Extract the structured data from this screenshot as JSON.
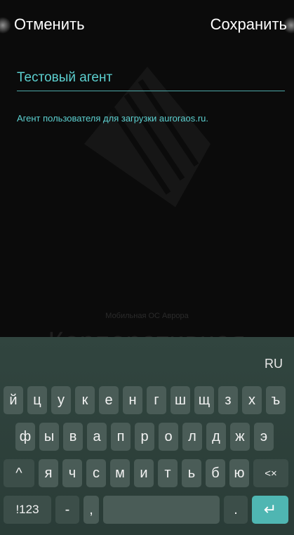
{
  "header": {
    "cancel_label": "Отменить",
    "save_label": "Сохранить"
  },
  "form": {
    "name_value": "Тестовый агент",
    "description": "Агент пользователя для загрузки auroraos.ru."
  },
  "background": {
    "caption": "Мобильная ОС Аврора",
    "big_text": "Корпоративная"
  },
  "keyboard": {
    "language": "RU",
    "rows": [
      [
        "й",
        "ц",
        "у",
        "к",
        "е",
        "н",
        "г",
        "ш",
        "щ",
        "з",
        "х",
        "ъ"
      ],
      [
        "ф",
        "ы",
        "в",
        "а",
        "п",
        "р",
        "о",
        "л",
        "д",
        "ж",
        "э"
      ],
      [
        "я",
        "ч",
        "с",
        "м",
        "и",
        "т",
        "ь",
        "б",
        "ю"
      ]
    ],
    "shift_label": "^",
    "backspace_label": "<×",
    "symbols_label": "!123",
    "dash_label": "-",
    "comma_label": ",",
    "period_label": ".",
    "enter_label": "↵"
  },
  "colors": {
    "accent": "#5cd0d0",
    "enter_key": "#4fb6b2",
    "keyboard_bg": "#31453f"
  }
}
